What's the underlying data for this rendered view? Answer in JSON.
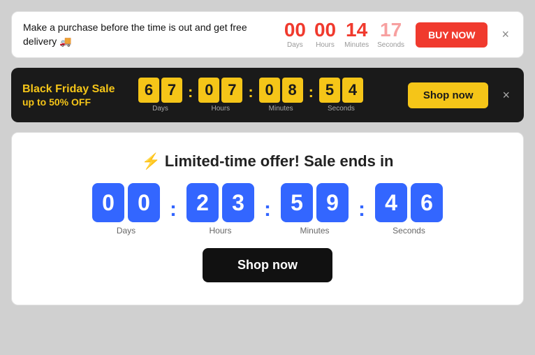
{
  "banner1": {
    "text": "Make a purchase before the time is out and get free delivery 🚚",
    "countdown": {
      "days": {
        "value": "00",
        "label": "Days",
        "color": "red"
      },
      "hours": {
        "value": "00",
        "label": "Hours",
        "color": "red"
      },
      "minutes": {
        "value": "14",
        "label": "Minutes",
        "color": "red"
      },
      "seconds": {
        "value": "17",
        "label": "Seconds",
        "color": "pink"
      }
    },
    "buy_now": "BUY NOW",
    "close": "×"
  },
  "banner2": {
    "title": "Black Friday Sale",
    "subtitle": "up to 50% OFF",
    "countdown": {
      "days": {
        "d1": "6",
        "d2": "7",
        "label": "Days"
      },
      "hours": {
        "d1": "0",
        "d2": "7",
        "label": "Hours"
      },
      "minutes": {
        "d1": "0",
        "d2": "8",
        "label": "Minutes"
      },
      "seconds": {
        "d1": "5",
        "d2": "4",
        "label": "Seconds"
      }
    },
    "shop_now": "Shop now",
    "close": "×"
  },
  "banner3": {
    "icon": "⚡",
    "title": "Limited-time offer! Sale ends in",
    "countdown": {
      "days": {
        "d1": "0",
        "d2": "0",
        "label": "Days"
      },
      "hours": {
        "d1": "2",
        "d2": "3",
        "label": "Hours"
      },
      "minutes": {
        "d1": "5",
        "d2": "9",
        "label": "Minutes"
      },
      "seconds": {
        "d1": "4",
        "d2": "6",
        "label": "Seconds"
      }
    },
    "shop_now": "Shop now"
  }
}
